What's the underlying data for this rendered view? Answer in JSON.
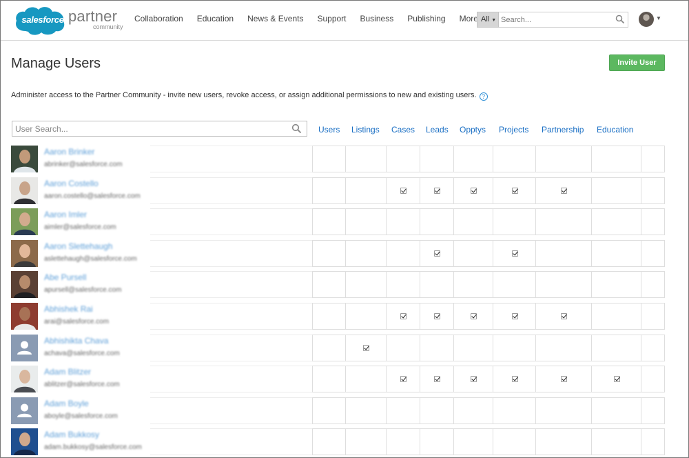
{
  "header": {
    "logo_cloud_text": "salesforce",
    "logo_partner_text": "partner",
    "logo_community_text": "community",
    "nav": [
      "Collaboration",
      "Education",
      "News & Events",
      "Support",
      "Business",
      "Publishing",
      "More"
    ],
    "search_scope": "All",
    "search_placeholder": "Search..."
  },
  "page": {
    "title": "Manage Users",
    "invite_button": "Invite User",
    "description": "Administer access to the Partner Community - invite new users, revoke access, or assign additional permissions to new and existing users.",
    "user_search_placeholder": "User Search..."
  },
  "columns": [
    "Users",
    "Listings",
    "Cases",
    "Leads",
    "Opptys",
    "Projects",
    "Partnership",
    "Education"
  ],
  "users": [
    {
      "name": "Aaron Brinker",
      "email": "abrinker@salesforce.com",
      "photo": "photo-dark",
      "perms": [
        false,
        false,
        false,
        false,
        false,
        false,
        false,
        false,
        false
      ]
    },
    {
      "name": "Aaron Costello",
      "email": "aaron.costello@salesforce.com",
      "photo": "photo-light",
      "perms": [
        false,
        false,
        true,
        true,
        true,
        true,
        true,
        false,
        false
      ]
    },
    {
      "name": "Aaron Imler",
      "email": "aimler@salesforce.com",
      "photo": "photo-green",
      "perms": [
        false,
        false,
        false,
        false,
        false,
        false,
        false,
        false,
        false
      ]
    },
    {
      "name": "Aaron Slettehaugh",
      "email": "aslettehaugh@salesforce.com",
      "photo": "photo-warm",
      "perms": [
        false,
        false,
        false,
        true,
        false,
        true,
        false,
        false,
        false
      ]
    },
    {
      "name": "Abe Pursell",
      "email": "apursell@salesforce.com",
      "photo": "photo-brown",
      "perms": [
        false,
        false,
        false,
        false,
        false,
        false,
        false,
        false,
        false
      ]
    },
    {
      "name": "Abhishek Rai",
      "email": "arai@salesforce.com",
      "photo": "photo-red",
      "perms": [
        false,
        false,
        true,
        true,
        true,
        true,
        true,
        false,
        false
      ]
    },
    {
      "name": "Abhishikta Chava",
      "email": "achava@salesforce.com",
      "photo": "placeholder",
      "perms": [
        false,
        true,
        false,
        false,
        false,
        false,
        false,
        false,
        false
      ]
    },
    {
      "name": "Adam Blitzer",
      "email": "ablitzer@salesforce.com",
      "photo": "photo-pale",
      "perms": [
        false,
        false,
        true,
        true,
        true,
        true,
        true,
        true,
        false
      ]
    },
    {
      "name": "Adam Boyle",
      "email": "aboyle@salesforce.com",
      "photo": "placeholder",
      "perms": [
        false,
        false,
        false,
        false,
        false,
        false,
        false,
        false,
        false
      ]
    },
    {
      "name": "Adam Bukkosy",
      "email": "adam.bukkosy@salesforce.com",
      "photo": "photo-blue",
      "perms": [
        false,
        false,
        false,
        false,
        false,
        false,
        false,
        false,
        false
      ]
    }
  ],
  "colors": {
    "link": "#1a6fc4",
    "invite_button": "#5cb860",
    "brand_cloud": "#1798c1"
  }
}
